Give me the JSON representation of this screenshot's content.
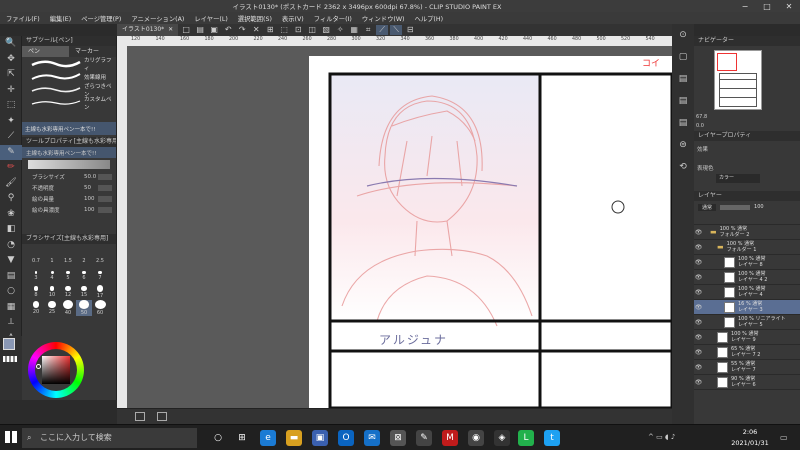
{
  "window": {
    "title": "イラスト0130* (ポストカード 2362 x 3496px 600dpi 67.8%)  - CLIP STUDIO PAINT EX",
    "min": "−",
    "max": "□",
    "close": "✕"
  },
  "menu": [
    "ファイル(F)",
    "編集(E)",
    "ページ管理(P)",
    "アニメーション(A)",
    "レイヤー(L)",
    "選択範囲(S)",
    "表示(V)",
    "フィルター(I)",
    "ウィンドウ(W)",
    "ヘルプ(H)"
  ],
  "document_tab": {
    "label": "イラスト0130*",
    "close": "✕"
  },
  "subtool": {
    "header": "サブツール[ペン]",
    "tabs": [
      "ペン",
      "マーカー"
    ],
    "brushes": [
      "カリグラフィ",
      "効果線用",
      "ざらつきペン",
      "カスタムペン"
    ],
    "selected": "主線も水彩専用ペン一本で!!"
  },
  "tool_property": {
    "header": "ツールプロパティ[主線も水彩専用ペン]",
    "selected_name": "主線も水彩専用ペン一本で!!",
    "rows": [
      {
        "label": "ブラシサイズ",
        "value": "50.0"
      },
      {
        "label": "不透明度",
        "value": "50"
      },
      {
        "label": "絵の具量",
        "value": "100"
      },
      {
        "label": "絵の具濃度",
        "value": "100"
      }
    ]
  },
  "brush_size": {
    "header": "ブラシサイズ[主線も水彩専用]",
    "sizes": [
      "0.7",
      "1",
      "1.5",
      "2",
      "2.5",
      "3",
      "4",
      "5",
      "6",
      "7",
      "8",
      "10",
      "12",
      "15",
      "17",
      "20",
      "25",
      "40",
      "50",
      "60"
    ],
    "selected": "50"
  },
  "canvas": {
    "ruler_marks": [
      "120",
      "140",
      "160",
      "180",
      "200",
      "220",
      "240",
      "260",
      "280",
      "300",
      "320",
      "340",
      "360",
      "380",
      "400",
      "420",
      "440",
      "460",
      "480",
      "500",
      "520",
      "540"
    ],
    "panel_text": "アルジュナ"
  },
  "navigator": {
    "header": "ナビゲーター",
    "zoom": "67.8",
    "angle": "0.0"
  },
  "layer_property": {
    "header": "レイヤープロパティ",
    "effect_label": "効果",
    "color_label": "表現色",
    "color_value": "カラー"
  },
  "layers": {
    "header": "レイヤー",
    "blend": "通常",
    "opacity": "100",
    "rows": [
      {
        "l1": "100 % 通常",
        "l2": "フォルダー 2",
        "type": "folder",
        "indent": 1,
        "sel": false
      },
      {
        "l1": "100 % 通常",
        "l2": "フォルダー 1",
        "type": "folder",
        "indent": 2,
        "sel": false
      },
      {
        "l1": "100 % 通常",
        "l2": "レイヤー 8",
        "type": "layer",
        "indent": 3,
        "sel": false
      },
      {
        "l1": "100 % 通常",
        "l2": "レイヤー 4 2",
        "type": "layer",
        "indent": 3,
        "sel": false
      },
      {
        "l1": "100 % 通常",
        "l2": "レイヤー 4",
        "type": "layer",
        "indent": 3,
        "sel": false
      },
      {
        "l1": "16 % 通常",
        "l2": "レイヤー 3",
        "type": "layer",
        "indent": 3,
        "sel": true
      },
      {
        "l1": "100 % リニアライト",
        "l2": "レイヤー 5",
        "type": "layer",
        "indent": 3,
        "sel": false
      },
      {
        "l1": "100 % 通常",
        "l2": "レイヤー 9",
        "type": "layer",
        "indent": 2,
        "sel": false
      },
      {
        "l1": "65 % 通常",
        "l2": "レイヤー 7 2",
        "type": "layer",
        "indent": 2,
        "sel": false
      },
      {
        "l1": "55 % 通常",
        "l2": "レイヤー 7",
        "type": "layer",
        "indent": 2,
        "sel": false
      },
      {
        "l1": "90 % 通常",
        "l2": "レイヤー 6",
        "type": "layer",
        "indent": 2,
        "sel": false
      }
    ]
  },
  "taskbar": {
    "search_placeholder": "ここに入力して検索",
    "time": "2:06",
    "date": "2021/01/31"
  }
}
